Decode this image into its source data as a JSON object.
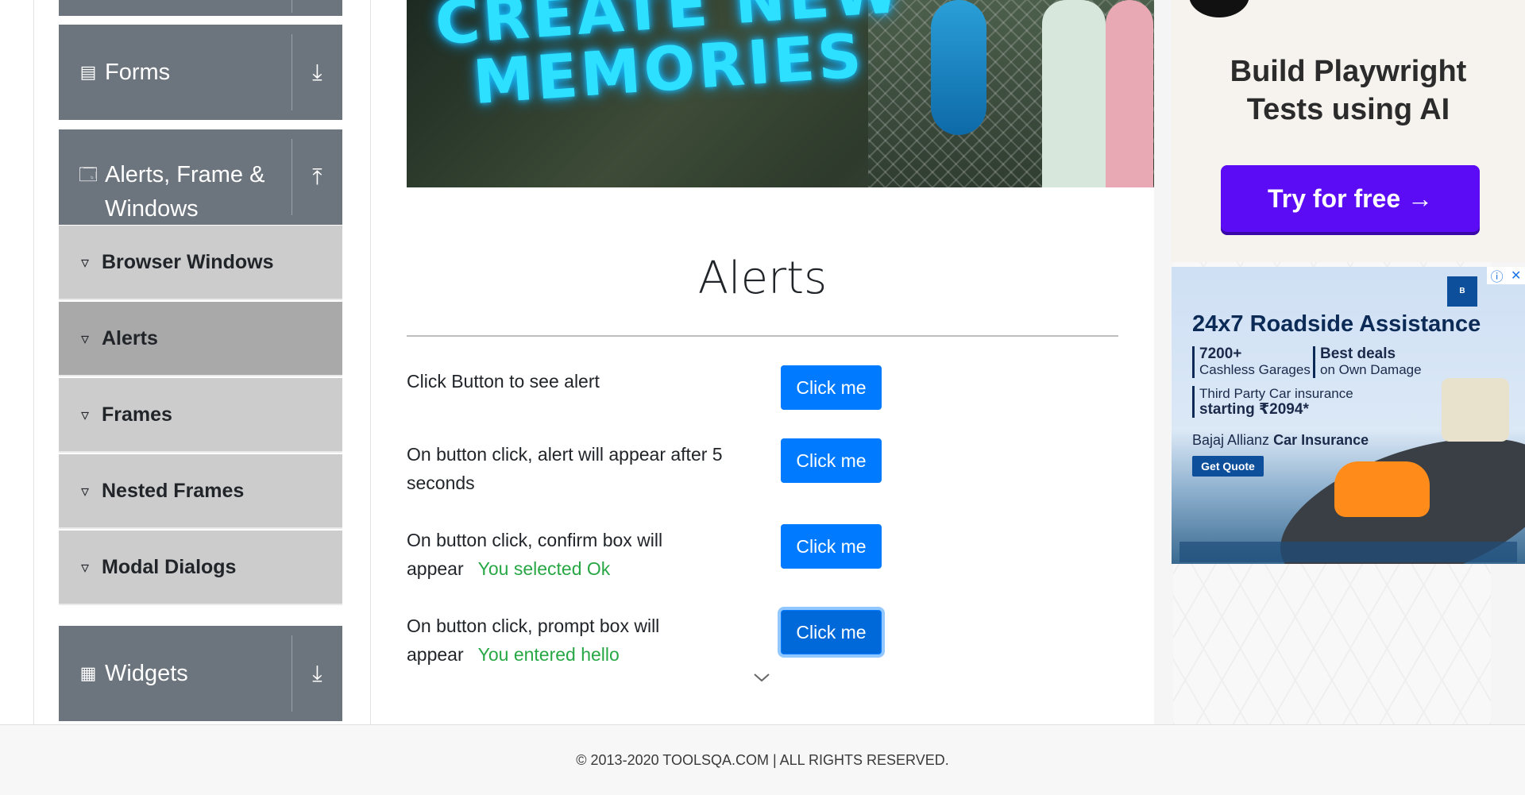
{
  "sidebar": {
    "groups": [
      {
        "label": "Forms",
        "icon": "form-icon",
        "arrow": "download-arrow-icon"
      },
      {
        "label": "Alerts, Frame & Windows",
        "icon": "window-icon",
        "arrow": "upload-arrow-icon"
      },
      {
        "label": "Widgets",
        "icon": "widgets-icon",
        "arrow": "download-arrow-icon"
      }
    ],
    "items": [
      {
        "label": "Browser Windows",
        "active": false
      },
      {
        "label": "Alerts",
        "active": true
      },
      {
        "label": "Frames",
        "active": false
      },
      {
        "label": "Nested Frames",
        "active": false
      },
      {
        "label": "Modal Dialogs",
        "active": false
      }
    ]
  },
  "banner": {
    "line1": "CREATE NEW",
    "line2": "MEMORIES"
  },
  "main": {
    "title": "Alerts",
    "rows": [
      {
        "text": "Click Button to see alert",
        "button": "Click me",
        "result": ""
      },
      {
        "text": "On button click, alert will appear after 5 seconds",
        "button": "Click me",
        "result": ""
      },
      {
        "text": "On button click, confirm box will appear",
        "button": "Click me",
        "result": "You selected Ok"
      },
      {
        "text": "On button click, prompt box will appear",
        "button": "Click me",
        "result": "You entered hello"
      }
    ]
  },
  "ads": {
    "ad1": {
      "headline_line1": "Build Playwright",
      "headline_line2": "Tests using AI",
      "cta": "Try for free →"
    },
    "ad2": {
      "headline": "24x7 Roadside Assistance",
      "stat1_value": "7200+",
      "stat1_label": "Cashless Garages",
      "stat2_value": "Best deals",
      "stat2_label": "on Own Damage",
      "stat3_line1": "Third Party Car insurance",
      "stat3_line2": "starting ₹2094*",
      "brand_prefix": "Bajaj Allianz",
      "brand_suffix": "Car Insurance",
      "cta": "Get Quote",
      "info_glyph": "ⓘ",
      "close_glyph": "✕"
    }
  },
  "footer": {
    "text": "© 2013-2020 TOOLSQA.COM | ALL RIGHTS RESERVED."
  },
  "colors": {
    "sidebar_group_bg": "#6c757d",
    "sidebar_item_bg": "#cccccc",
    "sidebar_item_active_bg": "#a9a9a9",
    "primary_button": "#007bff",
    "success_text": "#28a745",
    "ad_cta": "#5b0cf5"
  }
}
